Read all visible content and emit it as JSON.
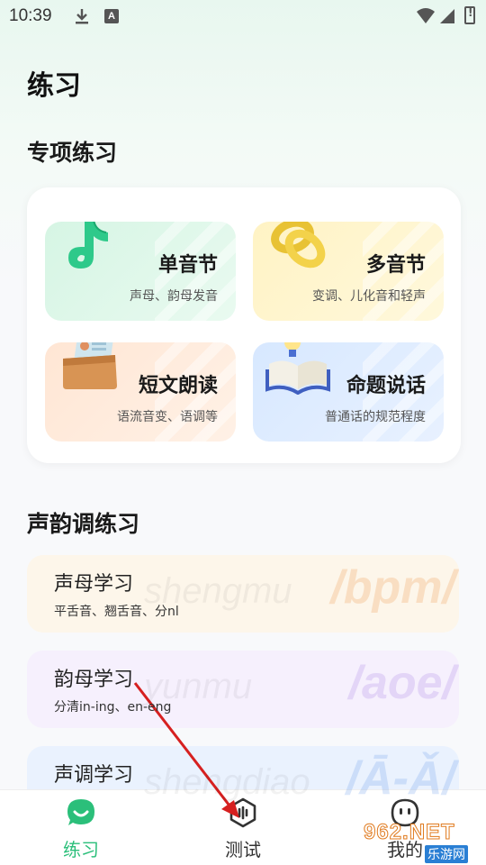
{
  "status_bar": {
    "time": "10:39",
    "a_badge": "A"
  },
  "page_title": "练习",
  "special_section": {
    "title": "专项练习",
    "cards": [
      {
        "title": "单音节",
        "subtitle": "声母、韵母发音",
        "icon": "music-note-icon"
      },
      {
        "title": "多音节",
        "subtitle": "变调、儿化音和轻声",
        "icon": "linked-rings-icon"
      },
      {
        "title": "短文朗读",
        "subtitle": "语流音变、语调等",
        "icon": "document-folder-icon"
      },
      {
        "title": "命题说话",
        "subtitle": "普通话的规范程度",
        "icon": "book-lightbulb-icon"
      }
    ]
  },
  "tone_section": {
    "title": "声韵调练习",
    "rows": [
      {
        "title": "声母学习",
        "subtitle": "平舌音、翘舌音、分nl",
        "bg_script": "shengmu",
        "bg_big": "/bpm/"
      },
      {
        "title": "韵母学习",
        "subtitle": "分清in-ing、en-eng",
        "bg_script": "yunmu",
        "bg_big": "/aoe/"
      },
      {
        "title": "声调学习",
        "subtitle": "",
        "bg_script": "shengdiao",
        "bg_big": "/Ā-Ǎ/"
      }
    ]
  },
  "tab_bar": {
    "tabs": [
      {
        "label": "练习",
        "icon": "chat-bubble-icon",
        "active": true
      },
      {
        "label": "测试",
        "icon": "hexagon-test-icon",
        "active": false
      },
      {
        "label": "我的",
        "icon": "face-icon",
        "active": false
      }
    ]
  },
  "watermark": {
    "main": "962.NET",
    "sub": "乐游网"
  },
  "colors": {
    "accent": "#2bbf7a",
    "arrow": "#d62020"
  }
}
